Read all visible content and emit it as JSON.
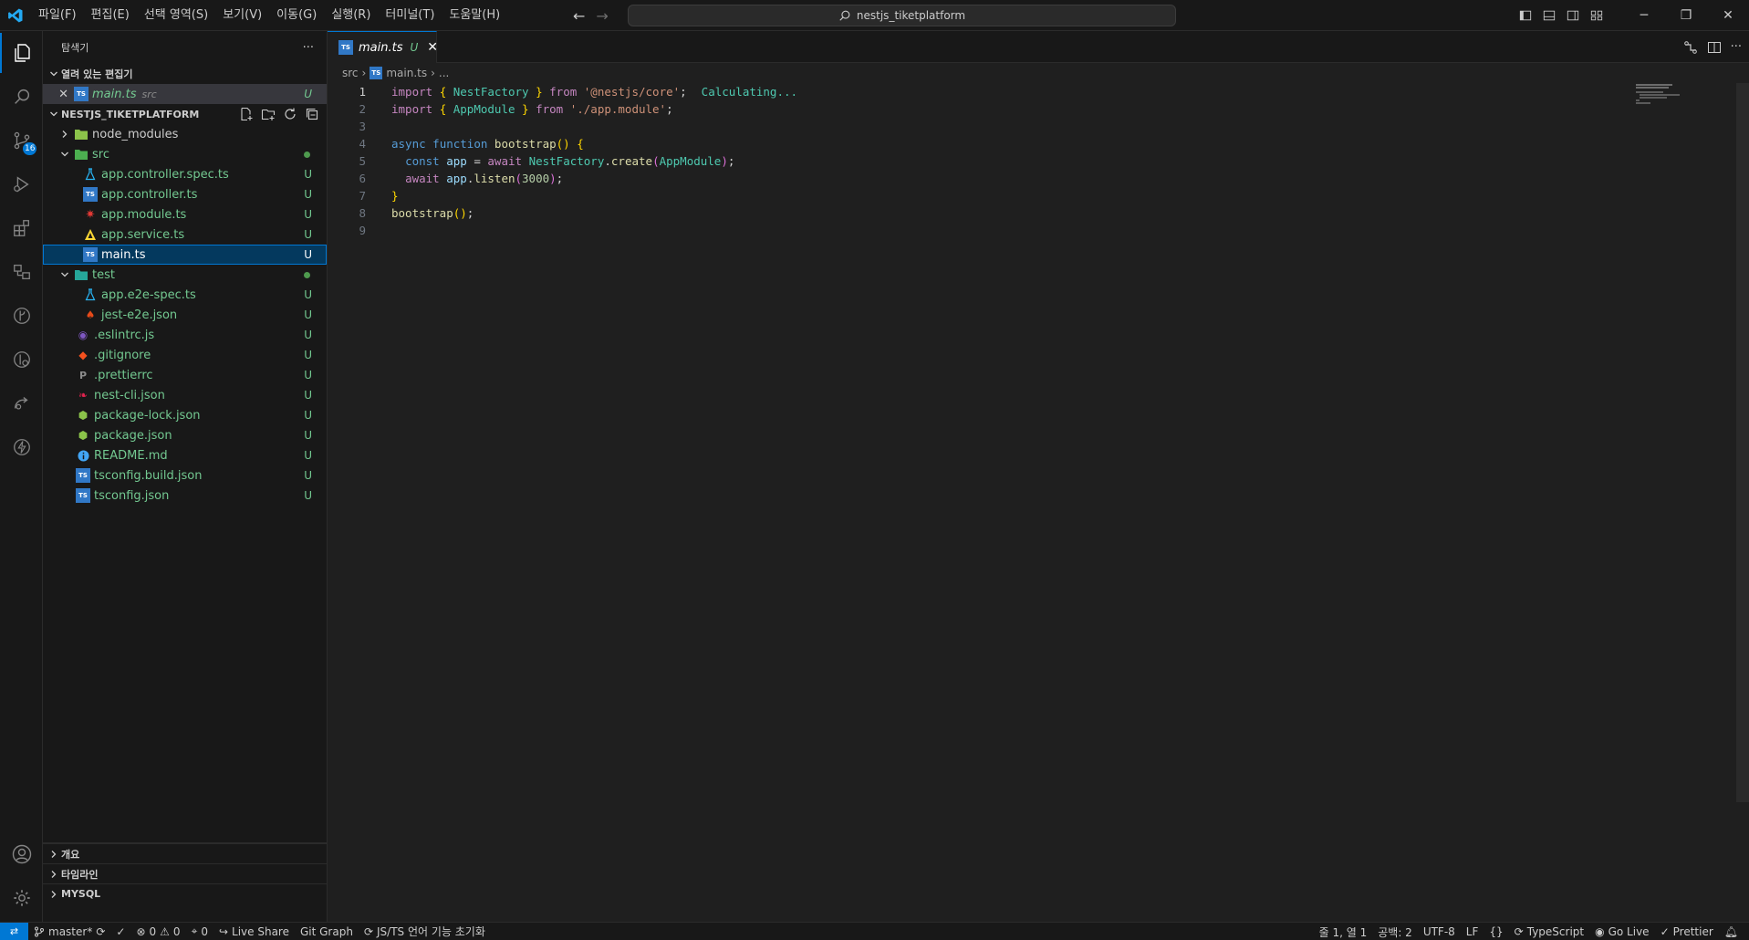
{
  "menu": [
    "파일(F)",
    "편집(E)",
    "선택 영역(S)",
    "보기(V)",
    "이동(G)",
    "실행(R)",
    "터미널(T)",
    "도움말(H)"
  ],
  "command_center": "nestjs_tiketplatform",
  "activity": {
    "scm_badge": "16"
  },
  "sidebar": {
    "title": "탐색기",
    "more": "···",
    "open_editors": {
      "label": "열려 있는 편집기",
      "item": {
        "name": "main.ts",
        "path": "src",
        "status": "U"
      }
    },
    "project": {
      "label": "NESTJS_TIKETPLATFORM",
      "items": [
        {
          "name": "node_modules",
          "status": ""
        },
        {
          "name": "src",
          "status": ""
        },
        {
          "name": "app.controller.spec.ts",
          "status": "U"
        },
        {
          "name": "app.controller.ts",
          "status": "U"
        },
        {
          "name": "app.module.ts",
          "status": "U"
        },
        {
          "name": "app.service.ts",
          "status": "U"
        },
        {
          "name": "main.ts",
          "status": "U"
        },
        {
          "name": "test",
          "status": ""
        },
        {
          "name": "app.e2e-spec.ts",
          "status": "U"
        },
        {
          "name": "jest-e2e.json",
          "status": "U"
        },
        {
          "name": ".eslintrc.js",
          "status": "U"
        },
        {
          "name": ".gitignore",
          "status": "U"
        },
        {
          "name": ".prettierrc",
          "status": "U"
        },
        {
          "name": "nest-cli.json",
          "status": "U"
        },
        {
          "name": "package-lock.json",
          "status": "U"
        },
        {
          "name": "package.json",
          "status": "U"
        },
        {
          "name": "README.md",
          "status": "U"
        },
        {
          "name": "tsconfig.build.json",
          "status": "U"
        },
        {
          "name": "tsconfig.json",
          "status": "U"
        }
      ]
    },
    "bottom_sections": [
      "개요",
      "타임라인",
      "MYSQL"
    ]
  },
  "editor": {
    "tab": {
      "name": "main.ts",
      "status": "U"
    },
    "breadcrumb": [
      "src",
      "main.ts",
      "..."
    ],
    "line_numbers": [
      "1",
      "2",
      "3",
      "4",
      "5",
      "6",
      "7",
      "8",
      "9"
    ],
    "inline_hint": "Calculating...",
    "code": {
      "l1": {
        "kw": "import",
        "ob": "{",
        "id": "NestFactory",
        "cb": "}",
        "from": "from",
        "str": "'@nestjs/core'",
        "semi": ";"
      },
      "l2": {
        "kw": "import",
        "ob": "{",
        "id": "AppModule",
        "cb": "}",
        "from": "from",
        "str": "'./app.module'",
        "semi": ";"
      },
      "l4": {
        "async": "async",
        "function": "function",
        "name": "bootstrap",
        "parens": "()",
        "brace": "{"
      },
      "l5": {
        "const": "const",
        "var": "app",
        "eq": "=",
        "await": "await",
        "obj": "NestFactory",
        "dot": ".",
        "method": "create",
        "op": "(",
        "arg": "AppModule",
        "cp": ")",
        "semi": ";"
      },
      "l6": {
        "await": "await",
        "obj": "app",
        "dot": ".",
        "method": "listen",
        "op": "(",
        "num": "3000",
        "cp": ")",
        "semi": ";"
      },
      "l7": {
        "brace": "}"
      },
      "l8": {
        "call": "bootstrap",
        "parens": "()",
        "semi": ";"
      }
    }
  },
  "statusbar": {
    "branch": "master*",
    "errors": "0",
    "warnings": "0",
    "ports": "0",
    "live_share": "Live Share",
    "git_graph": "Git Graph",
    "ts_init": "JS/TS 언어 기능 초기화",
    "position": "줄 1, 열 1",
    "spaces": "공백: 2",
    "encoding": "UTF-8",
    "eol": "LF",
    "braces": "{}",
    "language": "TypeScript",
    "go_live": "Go Live",
    "prettier": "Prettier"
  },
  "colors": {
    "accent": "#0078d4",
    "untracked": "#73c991",
    "background": "#1f1f1f",
    "chrome": "#181818"
  }
}
